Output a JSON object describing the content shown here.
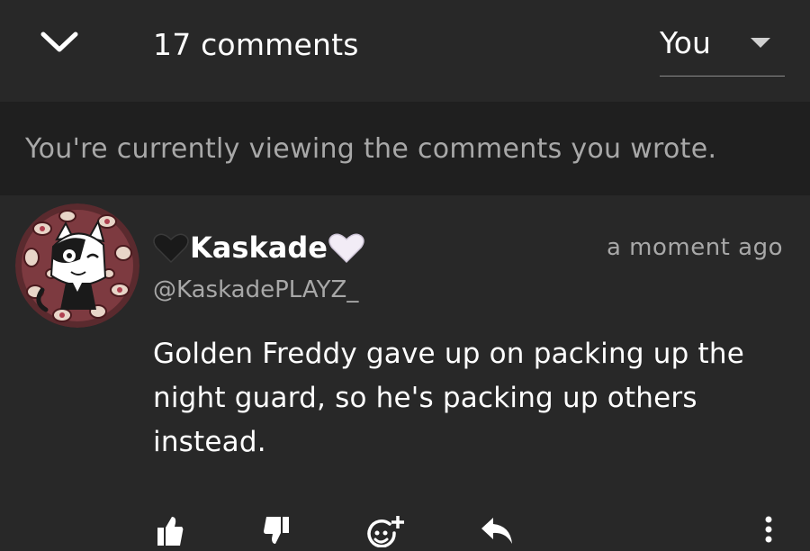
{
  "header": {
    "collapse_icon": "chevron-down-icon",
    "comment_count": "17 comments",
    "filter": {
      "value": "You",
      "icon": "caret-down-icon"
    }
  },
  "notice": {
    "text": "You're currently viewing the comments you wrote."
  },
  "comment": {
    "author": {
      "name": "Kaskade",
      "handle": "@KaskadePLAYZ_",
      "prefix_icon": "black-heart-icon",
      "suffix_icon": "white-heart-icon"
    },
    "timestamp": "a moment ago",
    "text": "Golden Freddy gave up on packing up the night guard, so he's packing up others instead.",
    "actions": [
      "like-icon",
      "dislike-icon",
      "add-emoji-icon",
      "reply-icon",
      "more-options-icon"
    ]
  },
  "colors": {
    "background": "#282828",
    "notice_background": "#1f1f1f",
    "primary_text": "#ffffff",
    "secondary_text": "#a8a8a8"
  }
}
